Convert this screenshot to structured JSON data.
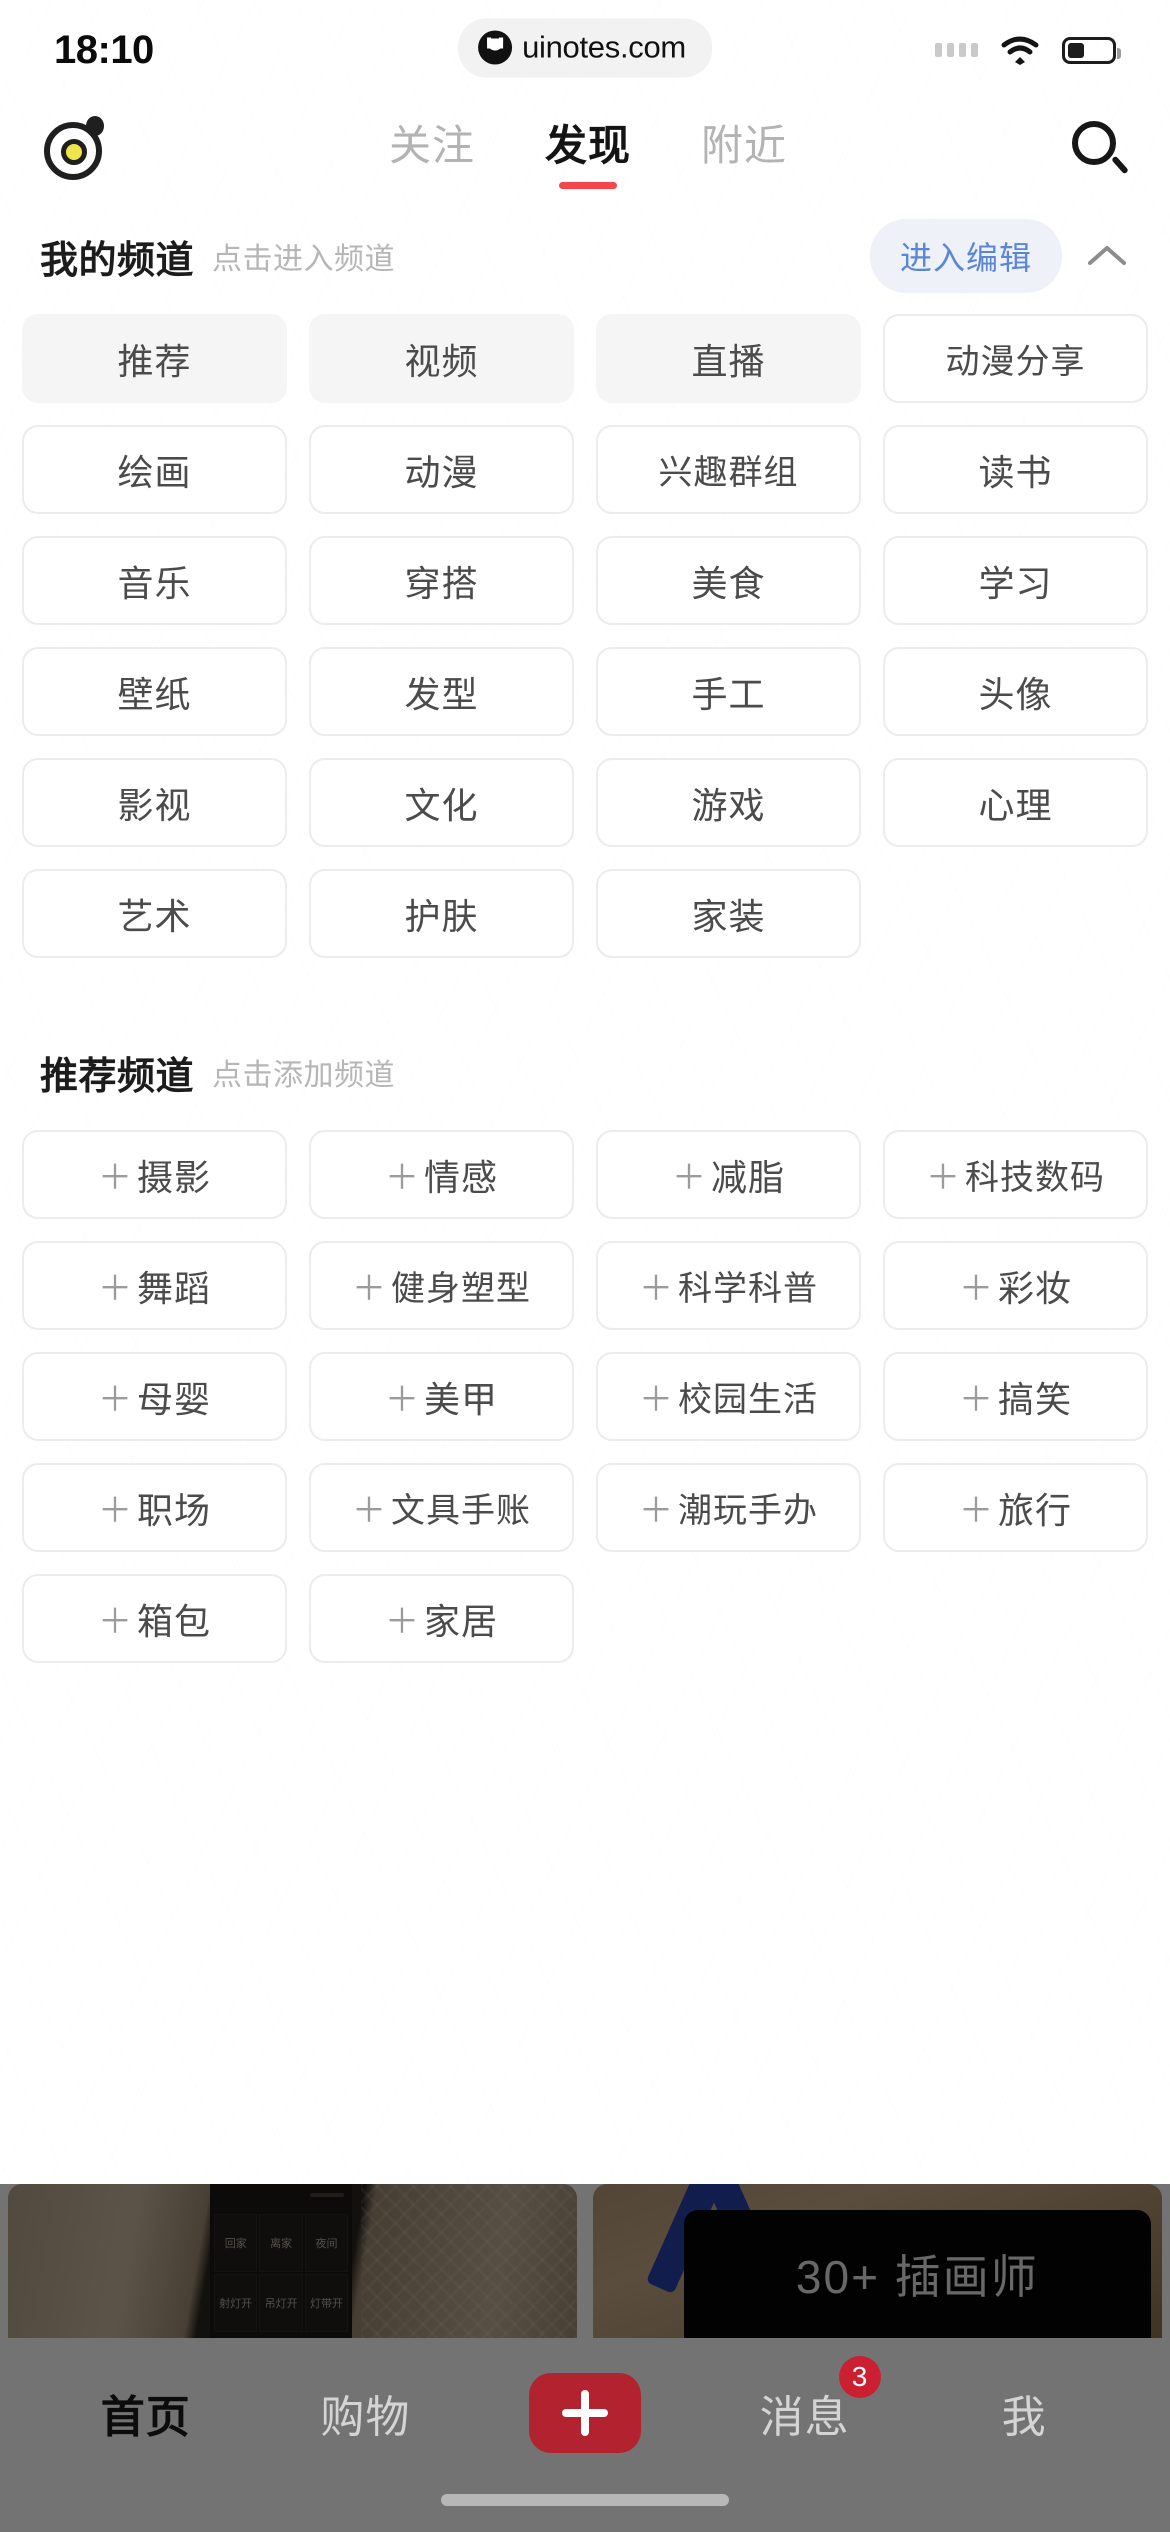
{
  "status_bar": {
    "time": "18:10",
    "watermark_text": "uinotes.com",
    "signal_icon": "signal-dots-icon",
    "wifi_icon": "wifi-icon",
    "battery_icon": "battery-icon"
  },
  "nav": {
    "logo_icon": "app-logo-icon",
    "search_icon": "search-icon",
    "tabs": [
      {
        "label": "关注",
        "active": false
      },
      {
        "label": "发现",
        "active": true
      },
      {
        "label": "附近",
        "active": false
      }
    ],
    "active_underline_color": "#f4464b"
  },
  "my_channels": {
    "title": "我的频道",
    "subtitle": "点击进入频道",
    "edit_button": "进入编辑",
    "edit_button_color": "#5b86d6",
    "collapse_icon": "chevron-up-icon",
    "items": [
      {
        "label": "推荐",
        "fixed": true
      },
      {
        "label": "视频",
        "fixed": true
      },
      {
        "label": "直播",
        "fixed": true
      },
      {
        "label": "动漫分享",
        "fixed": false
      },
      {
        "label": "绘画",
        "fixed": false
      },
      {
        "label": "动漫",
        "fixed": false
      },
      {
        "label": "兴趣群组",
        "fixed": false
      },
      {
        "label": "读书",
        "fixed": false
      },
      {
        "label": "音乐",
        "fixed": false
      },
      {
        "label": "穿搭",
        "fixed": false
      },
      {
        "label": "美食",
        "fixed": false
      },
      {
        "label": "学习",
        "fixed": false
      },
      {
        "label": "壁纸",
        "fixed": false
      },
      {
        "label": "发型",
        "fixed": false
      },
      {
        "label": "手工",
        "fixed": false
      },
      {
        "label": "头像",
        "fixed": false
      },
      {
        "label": "影视",
        "fixed": false
      },
      {
        "label": "文化",
        "fixed": false
      },
      {
        "label": "游戏",
        "fixed": false
      },
      {
        "label": "心理",
        "fixed": false
      },
      {
        "label": "艺术",
        "fixed": false
      },
      {
        "label": "护肤",
        "fixed": false
      },
      {
        "label": "家装",
        "fixed": false
      }
    ]
  },
  "recommended_channels": {
    "title": "推荐频道",
    "subtitle": "点击添加频道",
    "add_prefix": "＋",
    "items": [
      {
        "label": "摄影"
      },
      {
        "label": "情感"
      },
      {
        "label": "减脂"
      },
      {
        "label": "科技数码"
      },
      {
        "label": "舞蹈"
      },
      {
        "label": "健身塑型"
      },
      {
        "label": "科学科普"
      },
      {
        "label": "彩妆"
      },
      {
        "label": "母婴"
      },
      {
        "label": "美甲"
      },
      {
        "label": "校园生活"
      },
      {
        "label": "搞笑"
      },
      {
        "label": "职场"
      },
      {
        "label": "文具手账"
      },
      {
        "label": "潮玩手办"
      },
      {
        "label": "旅行"
      },
      {
        "label": "箱包"
      },
      {
        "label": "家居"
      }
    ]
  },
  "feed_preview": {
    "left_card": {
      "name": "smart-home-panel-photo",
      "panel_buttons": [
        "回家",
        "离家",
        "夜间",
        "射灯开",
        "吊灯开",
        "灯带开"
      ]
    },
    "right_card": {
      "name": "illustrator-sign-photo",
      "sign_text": "30+ 插画师"
    }
  },
  "bottom_bar": {
    "items": [
      {
        "label": "首页",
        "active": true,
        "badge": ""
      },
      {
        "label": "购物",
        "active": false,
        "badge": ""
      },
      {
        "label": "消息",
        "active": false,
        "badge": "3"
      },
      {
        "label": "我",
        "active": false,
        "badge": ""
      }
    ],
    "create_button_icon": "plus-icon",
    "create_button_color": "#b3232f",
    "badge_color": "#ca2031"
  }
}
